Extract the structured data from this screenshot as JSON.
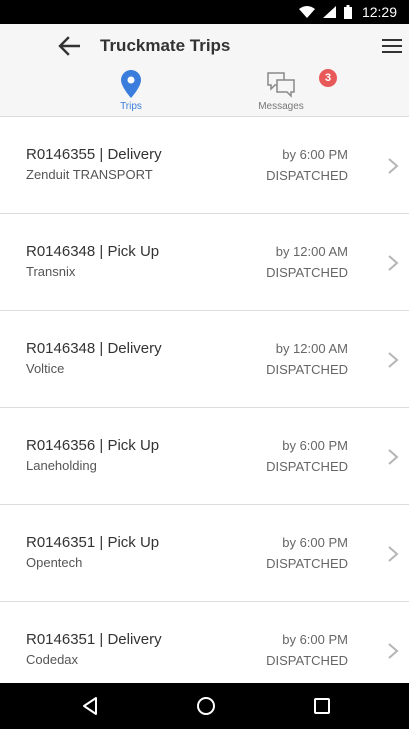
{
  "status_bar": {
    "time": "12:29"
  },
  "header": {
    "title": "Truckmate Trips"
  },
  "tabs": [
    {
      "label": "Trips",
      "icon": "map-pin-icon",
      "active": true
    },
    {
      "label": "Messages",
      "icon": "chat-bubbles-icon",
      "badge": "3",
      "active": false
    }
  ],
  "trips": [
    {
      "id_type": "R0146355 | Delivery",
      "company": "Zenduit TRANSPORT",
      "time": "by 6:00 PM",
      "status": "DISPATCHED"
    },
    {
      "id_type": "R0146348 | Pick Up",
      "company": "Transnix",
      "time": "by 12:00 AM",
      "status": "DISPATCHED"
    },
    {
      "id_type": "R0146348 | Delivery",
      "company": "Voltice",
      "time": "by 12:00 AM",
      "status": "DISPATCHED"
    },
    {
      "id_type": "R0146356 | Pick Up",
      "company": "Laneholding",
      "time": "by 6:00 PM",
      "status": "DISPATCHED"
    },
    {
      "id_type": "R0146351 | Pick Up",
      "company": "Opentech",
      "time": "by 6:00 PM",
      "status": "DISPATCHED"
    },
    {
      "id_type": "R0146351 | Delivery",
      "company": "Codedax",
      "time": "by 6:00 PM",
      "status": "DISPATCHED"
    }
  ],
  "colors": {
    "accent": "#3b7ddd",
    "badge": "#e85a5a",
    "header_bg": "#f6f6f6"
  }
}
